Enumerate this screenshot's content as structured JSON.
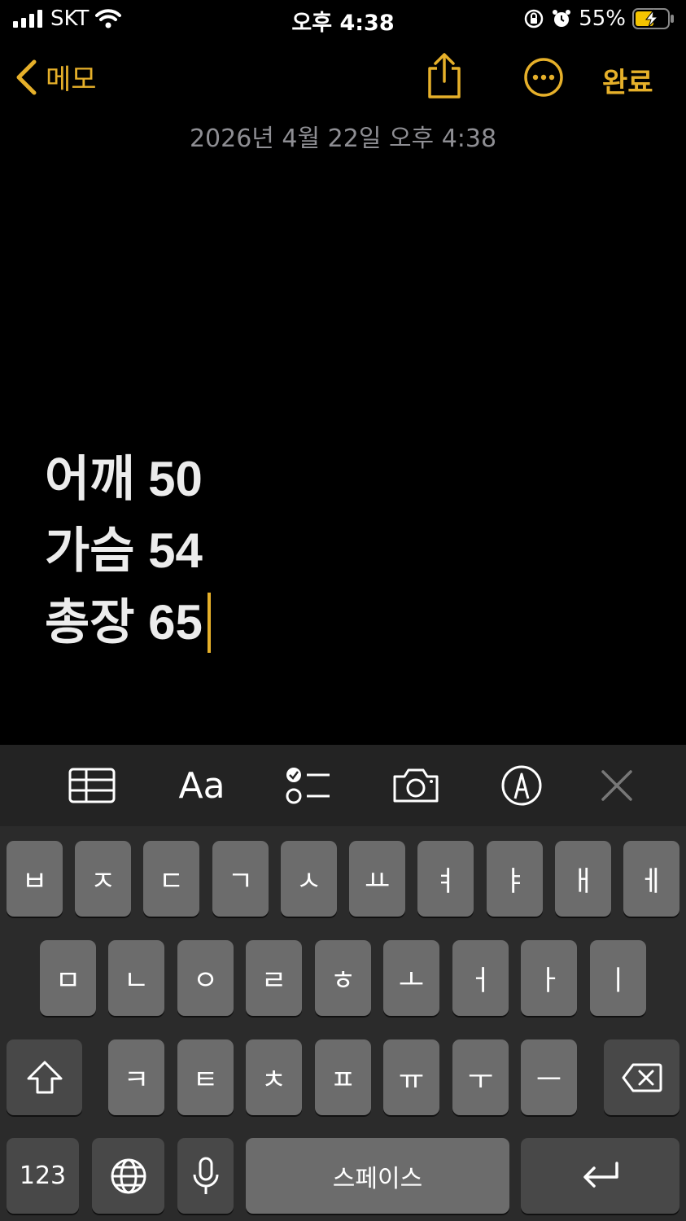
{
  "status_bar": {
    "carrier": "SKT",
    "time": "오후 4:38",
    "battery_percent": "55%",
    "signal_icon": "signal-bars-icon",
    "wifi_icon": "wifi-icon",
    "orientation_lock_icon": "orientation-lock-icon",
    "alarm_icon": "alarm-icon",
    "battery_icon": "battery-charging-icon"
  },
  "nav": {
    "back_label": "메모",
    "done_label": "완료",
    "share_icon": "share-icon",
    "more_icon": "more-ellipsis-icon"
  },
  "note": {
    "date": "2026년 4월 22일 오후 4:38",
    "lines": [
      "어깨 50",
      "가슴 54",
      "총장 65"
    ]
  },
  "toolbar": {
    "items": [
      "table-icon",
      "Aa",
      "checklist-icon",
      "camera-icon",
      "markup-pen-icon",
      "close-icon"
    ],
    "format_label": "Aa"
  },
  "keyboard": {
    "row1": [
      "ㅂ",
      "ㅈ",
      "ㄷ",
      "ㄱ",
      "ㅅ",
      "ㅛ",
      "ㅕ",
      "ㅑ",
      "ㅐ",
      "ㅔ"
    ],
    "row2": [
      "ㅁ",
      "ㄴ",
      "ㅇ",
      "ㄹ",
      "ㅎ",
      "ㅗ",
      "ㅓ",
      "ㅏ",
      "ㅣ"
    ],
    "row3": [
      "ㅋ",
      "ㅌ",
      "ㅊ",
      "ㅍ",
      "ㅠ",
      "ㅜ",
      "ㅡ"
    ],
    "numbers_label": "123",
    "space_label": "스페이스"
  },
  "colors": {
    "accent": "#e6b02a",
    "background": "#000000",
    "key": "#6c6c6c",
    "key_dark": "#484848"
  }
}
